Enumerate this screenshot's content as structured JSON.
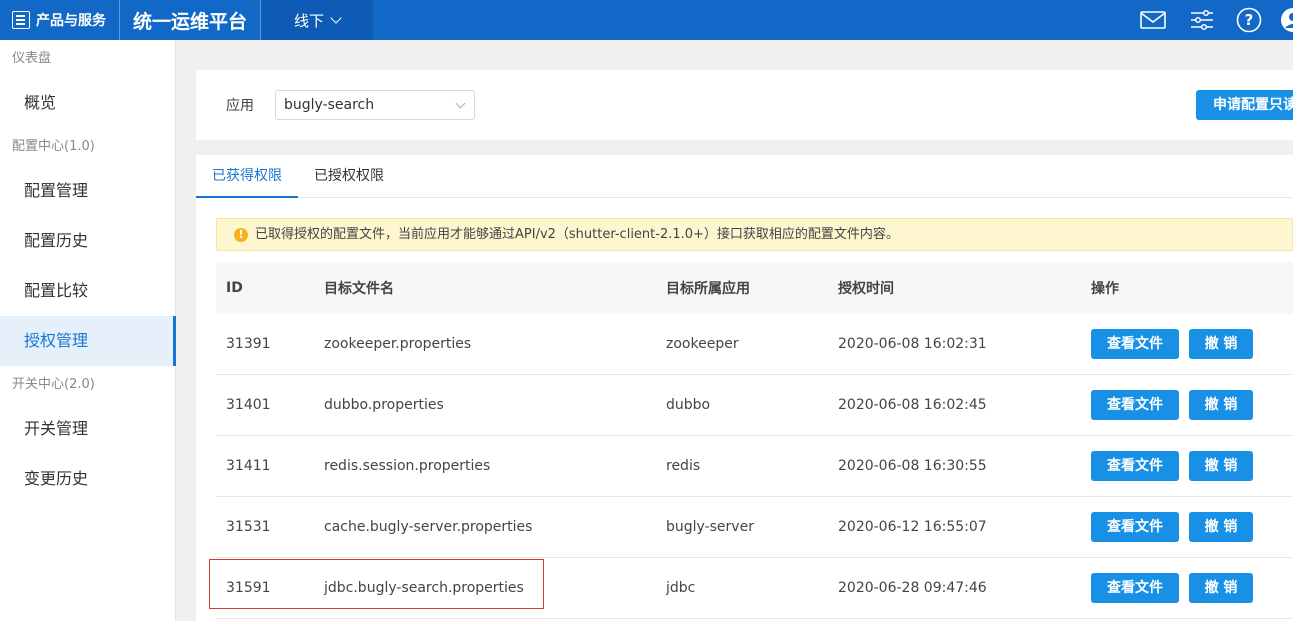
{
  "topbar": {
    "products_label": "产品与服务",
    "platform_title": "统一运维平台",
    "environment": "线下"
  },
  "sidebar": {
    "groups": [
      {
        "title": "仪表盘",
        "items": [
          "概览"
        ]
      },
      {
        "title": "配置中心(1.0)",
        "items": [
          "配置管理",
          "配置历史",
          "配置比较",
          "授权管理"
        ]
      },
      {
        "title": "开关中心(2.0)",
        "items": [
          "开关管理",
          "变更历史"
        ]
      }
    ],
    "active_item": "授权管理"
  },
  "filter": {
    "app_label": "应用",
    "app_value": "bugly-search",
    "apply_button": "申请配置只读"
  },
  "tabs": [
    {
      "label": "已获得权限",
      "active": true
    },
    {
      "label": "已授权权限",
      "active": false
    }
  ],
  "notice": "已取得授权的配置文件，当前应用才能够通过API/v2（shutter-client-2.1.0+）接口获取相应的配置文件内容。",
  "table": {
    "headers": [
      "ID",
      "目标文件名",
      "目标所属应用",
      "授权时间",
      "操作"
    ],
    "rows": [
      {
        "id": "31391",
        "file": "zookeeper.properties",
        "app": "zookeeper",
        "time": "2020-06-08 16:02:31"
      },
      {
        "id": "31401",
        "file": "dubbo.properties",
        "app": "dubbo",
        "time": "2020-06-08 16:02:45"
      },
      {
        "id": "31411",
        "file": "redis.session.properties",
        "app": "redis",
        "time": "2020-06-08 16:30:55"
      },
      {
        "id": "31531",
        "file": "cache.bugly-server.properties",
        "app": "bugly-server",
        "time": "2020-06-12 16:55:07"
      },
      {
        "id": "31591",
        "file": "jdbc.bugly-search.properties",
        "app": "jdbc",
        "time": "2020-06-28 09:47:46"
      }
    ],
    "view_button": "查看文件",
    "revoke_button": "撤 销"
  },
  "colors": {
    "topbar": "#1168c7",
    "accent": "#1890e6",
    "highlight": "#d0383f"
  }
}
